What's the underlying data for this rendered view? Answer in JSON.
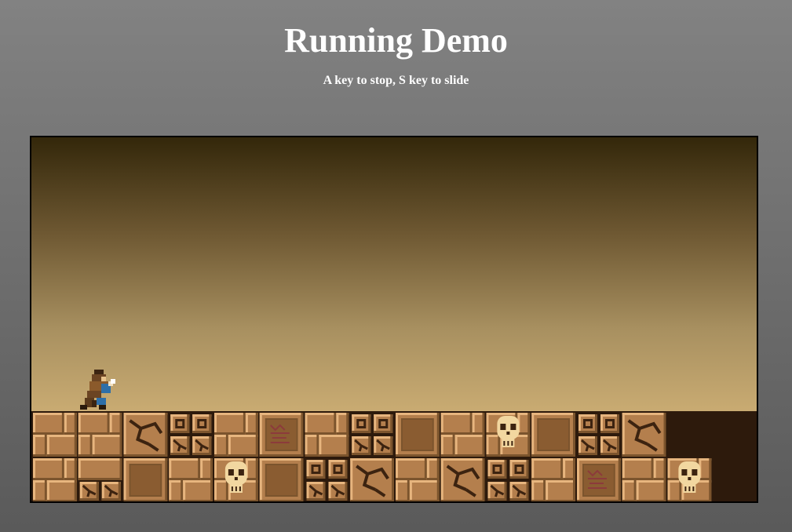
{
  "page": {
    "title": "Running Demo",
    "instructions": "A key to stop, S key to slide"
  },
  "game": {
    "sky_colors": [
      "#33270a",
      "#6e5832",
      "#a89060",
      "#c9ab72"
    ],
    "brick_colors": {
      "light": "#e7b57e",
      "base": "#b47f4d",
      "dark": "#7b542d",
      "shadow": "#3c2310",
      "mortar": "#2d1a0c"
    },
    "tile_rows": [
      [
        "bricks",
        "bricks",
        "cracked",
        "bricks_holes",
        "bricks",
        "glyph",
        "bricks",
        "bricks_holes",
        "slab",
        "bricks",
        "skull",
        "slab",
        "bricks_holes",
        "cracked"
      ],
      [
        "bricks",
        "bricks_cracked",
        "slab",
        "bricks",
        "skull",
        "slab",
        "bricks_holes",
        "cracked",
        "bricks",
        "cracked",
        "bricks_holes",
        "bricks",
        "glyph",
        "bricks",
        "skull"
      ]
    ],
    "player": {
      "state": "running",
      "icon": "runner-character-icon"
    }
  }
}
